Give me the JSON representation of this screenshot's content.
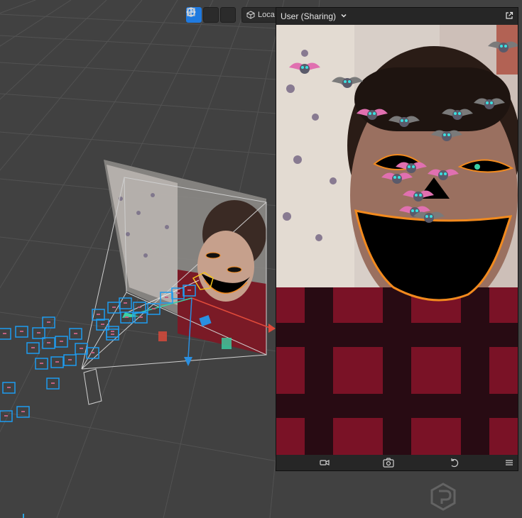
{
  "toolbar": {
    "tools": [
      {
        "name": "move-tool",
        "icon": "move-arrows-icon",
        "active": true
      },
      {
        "name": "rotate-tool",
        "icon": "rotate-icon",
        "active": false
      },
      {
        "name": "scale-tool",
        "icon": "scale-icon",
        "active": false
      }
    ],
    "space_label": "Loca",
    "space_icon": "cube-icon"
  },
  "preview": {
    "title": "User (Sharing)",
    "dropdown_icon": "chevron-down-icon",
    "popout_icon": "external-link-icon",
    "footer_buttons": [
      {
        "name": "video-camera-button",
        "icon": "video-camera-icon"
      },
      {
        "name": "switch-camera-button",
        "icon": "switch-camera-icon"
      },
      {
        "name": "reset-button",
        "icon": "rotate-left-icon"
      },
      {
        "name": "menu-button",
        "icon": "hamburger-menu-icon"
      }
    ]
  },
  "colors": {
    "accent": "#1f7ae0",
    "viewport_bg": "#414141",
    "grid": "#555555",
    "selection": "#1e9cf0",
    "axis_x": "#e04a3a",
    "axis_y": "#2a8fe0",
    "axis_z": "#3ccfa4",
    "flannel_red": "#8a1428",
    "face_orange": "#f28a1e"
  }
}
